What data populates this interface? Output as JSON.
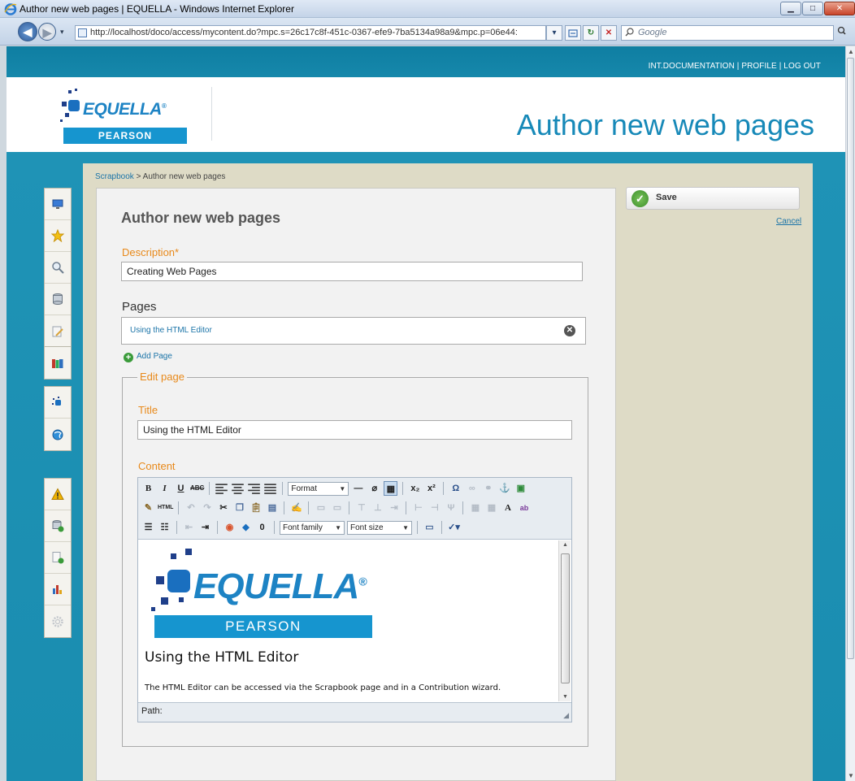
{
  "window": {
    "title": "Author new web pages | EQUELLA - Windows Internet Explorer",
    "min_glyph": "▁",
    "max_glyph": "□",
    "close_glyph": "✕"
  },
  "browser": {
    "back_glyph": "◀",
    "forward_glyph": "▶",
    "url": "http://localhost/doco/access/mycontent.do?mpc.s=26c17c8f-451c-0367-efe9-7ba5134a98a9&mpc.p=06e44:",
    "search_placeholder": "Google",
    "url_dropdown_glyph": "▾",
    "refresh_glyph": "↻",
    "stop_glyph": "✕",
    "search_glyph": "⚲"
  },
  "site": {
    "user_nav": "INT.DOCUMENTATION | PROFILE | LOG OUT",
    "logo_text": "EQUELLA",
    "logo_reg": "®",
    "logo_sub": "PEARSON",
    "page_heading": "Author new web pages"
  },
  "breadcrumb": {
    "parent": "Scrapbook",
    "separator": " > ",
    "current": "Author new web pages"
  },
  "form": {
    "title": "Author new web pages",
    "description_label": "Description*",
    "description_value": "Creating Web Pages",
    "pages_label": "Pages",
    "pages": [
      {
        "label": "Using the HTML Editor"
      }
    ],
    "add_page_label": "Add Page",
    "edit_page_legend": "Edit page",
    "title_label": "Title",
    "title_value": "Using the HTML Editor",
    "content_label": "Content"
  },
  "editor": {
    "format_select": "Format",
    "font_family_select": "Font family",
    "font_size_select": "Font size",
    "doc_heading": "Using the HTML Editor",
    "doc_paragraph": "The HTML Editor can be accessed via the Scrapbook page and in a Contribution wizard.",
    "path_label": "Path:"
  },
  "actions": {
    "save_label": "Save",
    "cancel_label": "Cancel"
  },
  "colors": {
    "accent_orange": "#e8891a",
    "brand_blue": "#1789b8",
    "link_blue": "#1b74a8",
    "teal_background": "#1a8db0"
  }
}
